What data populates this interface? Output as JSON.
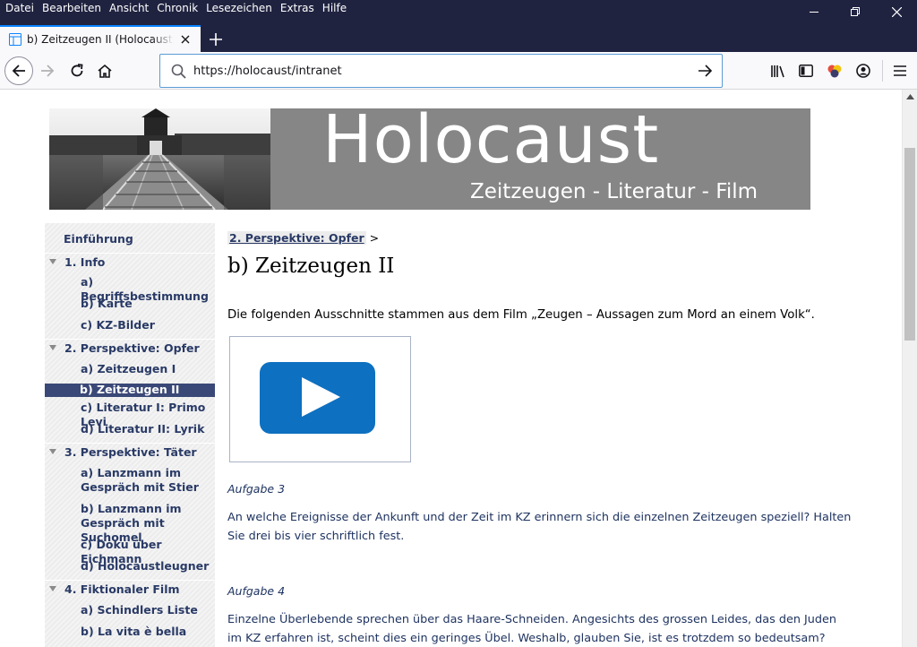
{
  "menu": [
    "Datei",
    "Bearbeiten",
    "Ansicht",
    "Chronik",
    "Lesezeichen",
    "Extras",
    "Hilfe"
  ],
  "tab": {
    "title": "b) Zeitzeugen II (Holocaustprojekt)"
  },
  "url": "https://holocaust/intranet",
  "banner": {
    "title": "Holocaust",
    "subtitle": "Zeitzeugen - Literatur - Film"
  },
  "sidebar": [
    {
      "label": "Einführung",
      "level": 1,
      "expander": false
    },
    {
      "label": "1. Info",
      "level": 1,
      "expander": true
    },
    {
      "label": "a) Begriffsbestimmung",
      "level": 2
    },
    {
      "label": "b) Karte",
      "level": 2
    },
    {
      "label": "c) KZ-Bilder",
      "level": 2
    },
    {
      "label": "2. Perspektive: Opfer",
      "level": 1,
      "expander": true
    },
    {
      "label": "a) Zeitzeugen I",
      "level": 2
    },
    {
      "label": "b) Zeitzeugen II",
      "level": 2,
      "active": true
    },
    {
      "label": "c) Literatur I: Primo Levi",
      "level": 2
    },
    {
      "label": "d) Literatur II: Lyrik",
      "level": 2
    },
    {
      "label": "3. Perspektive: Täter",
      "level": 1,
      "expander": true
    },
    {
      "label": "a) Lanzmann im",
      "label2": "Gespräch mit Stier",
      "level": 2
    },
    {
      "label": "b) Lanzmann im",
      "label2": "Gespräch mit Suchomel",
      "level": 2
    },
    {
      "label": "c) Doku über Eichmann",
      "level": 2
    },
    {
      "label": "d) Holocaustleugner",
      "level": 2
    },
    {
      "label": "4. Fiktionaler Film",
      "level": 1,
      "expander": true
    },
    {
      "label": "a) Schindlers Liste",
      "level": 2
    },
    {
      "label": "b) La vita è bella",
      "level": 2
    }
  ],
  "main": {
    "breadcrumb": "2. Perspektive: Opfer",
    "breadcrumb_sep": ">",
    "title": "b) Zeitzeugen II",
    "intro": "Die folgenden Ausschnitte stammen aus dem Film „Zeugen – Aussagen zum Mord an einem Volk“.",
    "tasks": [
      {
        "heading": "Aufgabe 3",
        "text": "An welche Ereignisse der Ankunft und der Zeit im KZ erinnern sich die einzelnen Zeitzeugen speziell? Halten Sie drei bis vier schriftlich fest."
      },
      {
        "heading": "Aufgabe 4",
        "text": "Einzelne Überlebende sprechen über das Haare-Schneiden. Angesichts des grossen Leides, das den Juden im KZ erfahren ist, scheint dies ein geringes Übel. Weshalb, glauben Sie, ist es trotzdem so bedeutsam?"
      }
    ]
  },
  "colors": {
    "chrome": "#202340",
    "nav_text": "#293a66",
    "active_nav": "#3a4877",
    "video_button": "#0e70c0",
    "task_text": "#1e3360"
  }
}
